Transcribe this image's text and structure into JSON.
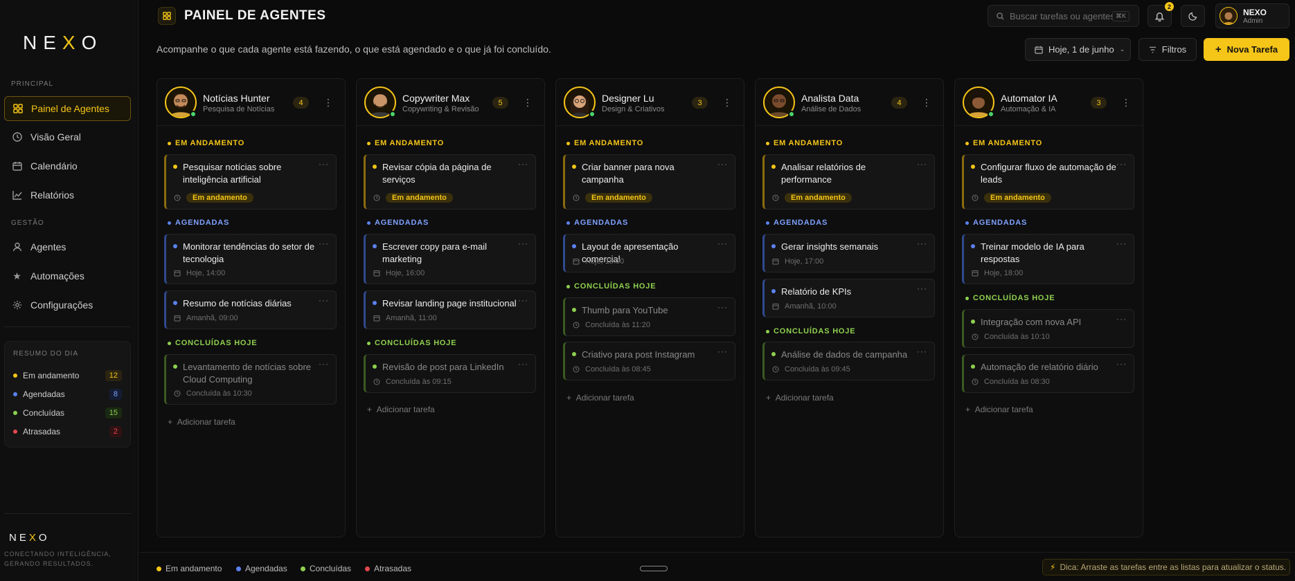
{
  "brand": {
    "logo_left": "NE",
    "logo_x": "X",
    "logo_right": "O",
    "footer_left": "NE",
    "footer_x": "X",
    "footer_right": "O",
    "tagline": "CONECTANDO INTELIGÊNCIA, GERANDO RESULTADOS."
  },
  "sidebar": {
    "section_principal": "PRINCIPAL",
    "section_gestao": "GESTÃO",
    "items": [
      {
        "label": "Painel de Agentes",
        "icon": "grid-icon"
      },
      {
        "label": "Visão Geral",
        "icon": "clock-icon"
      },
      {
        "label": "Calendário",
        "icon": "calendar-icon"
      },
      {
        "label": "Relatórios",
        "icon": "chart-icon"
      },
      {
        "label": "Agentes",
        "icon": "user-icon"
      },
      {
        "label": "Automações",
        "icon": "star-icon"
      },
      {
        "label": "Configurações",
        "icon": "gear-icon"
      }
    ],
    "summary": {
      "title": "RESUMO DO DIA",
      "rows": [
        {
          "label": "Em andamento",
          "count": "12",
          "color": "#f5c518"
        },
        {
          "label": "Agendadas",
          "count": "8",
          "color": "#5b82f0"
        },
        {
          "label": "Concluídas",
          "count": "15",
          "color": "#8fd14f"
        },
        {
          "label": "Atrasadas",
          "count": "2",
          "color": "#e5484d"
        }
      ]
    }
  },
  "header": {
    "title": "PAINEL DE AGENTES",
    "subtitle": "Acompanhe o que cada agente está fazendo, o que está agendado e o que já foi concluído.",
    "search_placeholder": "Buscar tarefas ou agentes...",
    "search_shortcut": "⌘K",
    "notif_count": "2",
    "user_name": "NEXO",
    "user_role": "Admin",
    "date_label": "Hoje, 1 de junho",
    "filters_label": "Filtros",
    "new_task_label": "Nova Tarefa"
  },
  "labels": {
    "in_progress": "EM ANDAMENTO",
    "scheduled": "AGENDADAS",
    "done_today": "CONCLUÍDAS HOJE",
    "status_pill": "Em andamento",
    "add_task": "Adicionar tarefa"
  },
  "columns": [
    {
      "name": "Notícias Hunter",
      "role": "Pesquisa de Notícias",
      "count": "4",
      "progress": {
        "title": "Pesquisar notícias sobre inteligência artificial"
      },
      "scheduled": [
        {
          "title": "Monitorar tendências do setor de tecnologia",
          "meta": "Hoje, 14:00"
        },
        {
          "title": "Resumo de notícias diárias",
          "meta": "Amanhã, 09:00"
        }
      ],
      "done": [
        {
          "title": "Levantamento de notícias sobre Cloud Computing",
          "meta": "Concluída às 10:30"
        }
      ]
    },
    {
      "name": "Copywriter Max",
      "role": "Copywriting & Revisão",
      "count": "5",
      "progress": {
        "title": "Revisar cópia da página de serviços"
      },
      "scheduled": [
        {
          "title": "Escrever copy para e-mail marketing",
          "meta": "Hoje, 16:00"
        },
        {
          "title": "Revisar landing page institucional",
          "meta": "Amanhã, 11:00"
        }
      ],
      "done": [
        {
          "title": "Revisão de post para LinkedIn",
          "meta": "Concluída às 09:15"
        }
      ]
    },
    {
      "name": "Designer Lu",
      "role": "Design & Criativos",
      "count": "3",
      "progress": {
        "title": "Criar banner para nova campanha"
      },
      "scheduled": [
        {
          "title": "Layout de apresentação comercial",
          "meta": "Hoje, 15:00"
        }
      ],
      "done": [
        {
          "title": "Thumb para YouTube",
          "meta": "Concluída às 11:20"
        },
        {
          "title": "Criativo para post Instagram",
          "meta": "Concluída às 08:45"
        }
      ]
    },
    {
      "name": "Analista Data",
      "role": "Análise de Dados",
      "count": "4",
      "progress": {
        "title": "Analisar relatórios de performance"
      },
      "scheduled": [
        {
          "title": "Gerar insights semanais",
          "meta": "Hoje, 17:00"
        },
        {
          "title": "Relatório de KPIs",
          "meta": "Amanhã, 10:00"
        }
      ],
      "done": [
        {
          "title": "Análise de dados de campanha",
          "meta": "Concluída às 09:45"
        }
      ]
    },
    {
      "name": "Automator IA",
      "role": "Automação & IA",
      "count": "3",
      "progress": {
        "title": "Configurar fluxo de automação de leads"
      },
      "scheduled": [
        {
          "title": "Treinar modelo de IA para respostas",
          "meta": "Hoje, 18:00"
        }
      ],
      "done": [
        {
          "title": "Integração com nova API",
          "meta": "Concluída às 10:10"
        },
        {
          "title": "Automação de relatório diário",
          "meta": "Concluída às 08:30"
        }
      ]
    }
  ],
  "footer": {
    "legend": [
      {
        "label": "Em andamento",
        "color": "#f5c518"
      },
      {
        "label": "Agendadas",
        "color": "#5b82f0"
      },
      {
        "label": "Concluídas",
        "color": "#8fd14f"
      },
      {
        "label": "Atrasadas",
        "color": "#e5484d"
      }
    ],
    "tip": "Dica: Arraste as tarefas entre as listas para atualizar o status."
  }
}
